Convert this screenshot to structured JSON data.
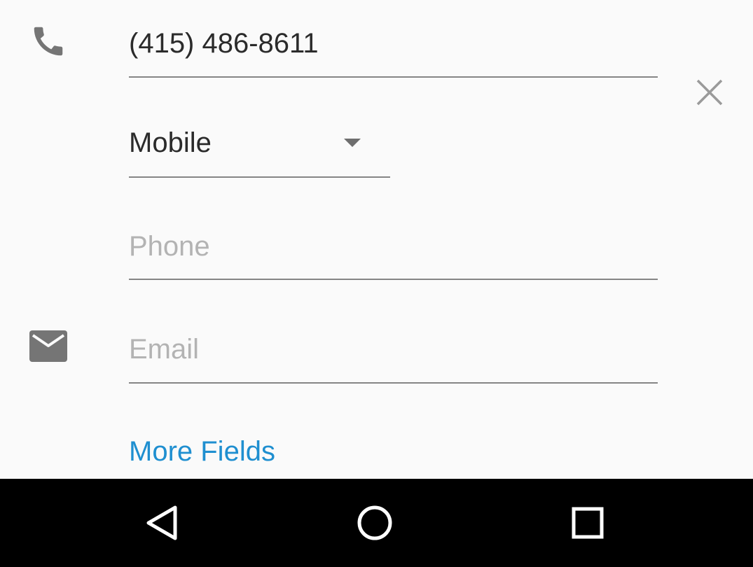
{
  "form": {
    "phone_value": "(415) 486-8611",
    "phone_type": "Mobile",
    "phone_placeholder": "Phone",
    "email_placeholder": "Email",
    "more_fields_label": "More Fields"
  },
  "icons": {
    "phone": "phone-icon",
    "email": "email-icon",
    "clear": "close-icon",
    "dropdown": "caret-down-icon"
  },
  "navbar": {
    "buttons": [
      "back",
      "home",
      "recents"
    ]
  },
  "colors": {
    "background": "#fafafa",
    "text": "#2b2b2b",
    "placeholder": "#b3b3b3",
    "underline": "#858585",
    "icon": "#757575",
    "accent": "#1f8fd0",
    "navbar": "#000000"
  }
}
